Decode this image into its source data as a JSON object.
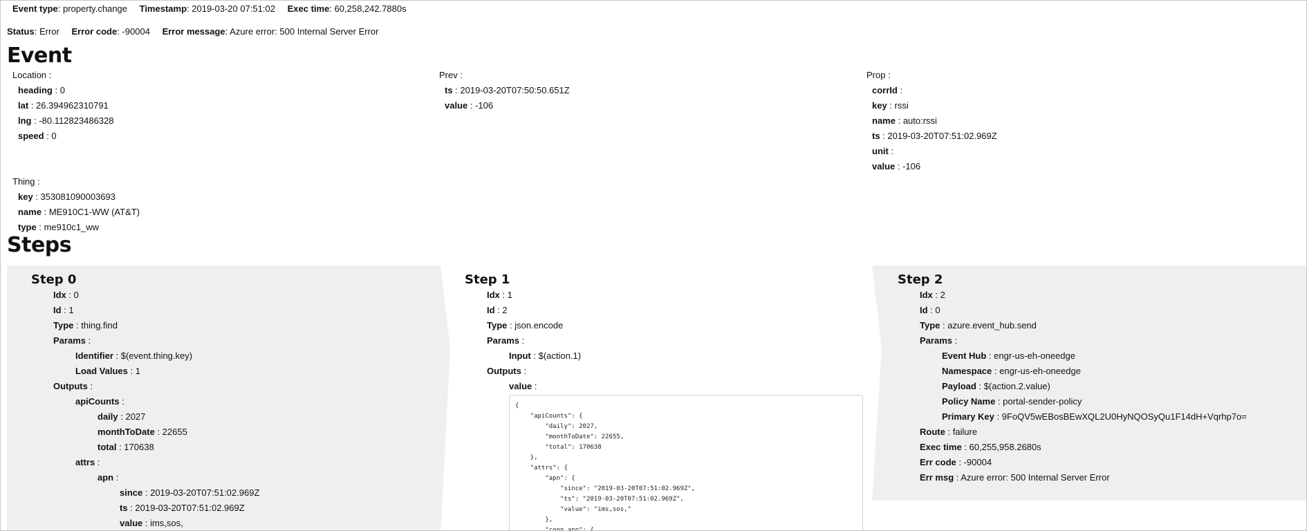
{
  "header": {
    "event_type_label": "Event type",
    "event_type": "property.change",
    "timestamp_label": "Timestamp",
    "timestamp": "2019-03-20 07:51:02",
    "exec_time_label": "Exec time",
    "exec_time": "60,258,242.7880s",
    "status_label": "Status",
    "status": "Error",
    "error_code_label": "Error code",
    "error_code": "-90004",
    "error_message_label": "Error message",
    "error_message": "Azure error: 500 Internal Server Error"
  },
  "event": {
    "title": "Event",
    "location": {
      "label": "Location",
      "fields": [
        {
          "k": "heading",
          "v": "0"
        },
        {
          "k": "lat",
          "v": "26.394962310791"
        },
        {
          "k": "lng",
          "v": "-80.112823486328"
        },
        {
          "k": "speed",
          "v": "0"
        }
      ]
    },
    "thing": {
      "label": "Thing",
      "fields": [
        {
          "k": "key",
          "v": "353081090003693"
        },
        {
          "k": "name",
          "v": "ME910C1-WW (AT&T)"
        },
        {
          "k": "type",
          "v": "me910c1_ww"
        }
      ]
    },
    "prev": {
      "label": "Prev",
      "fields": [
        {
          "k": "ts",
          "v": "2019-03-20T07:50:50.651Z"
        },
        {
          "k": "value",
          "v": "-106"
        }
      ]
    },
    "prop": {
      "label": "Prop",
      "fields": [
        {
          "k": "corrId",
          "v": ""
        },
        {
          "k": "key",
          "v": "rssi"
        },
        {
          "k": "name",
          "v": "auto:rssi"
        },
        {
          "k": "ts",
          "v": "2019-03-20T07:51:02.969Z"
        },
        {
          "k": "unit",
          "v": ""
        },
        {
          "k": "value",
          "v": "-106"
        }
      ]
    }
  },
  "steps": {
    "title": "Steps",
    "items": [
      {
        "title": "Step 0",
        "lines": [
          {
            "k": "Idx",
            "v": "0",
            "indent": 0
          },
          {
            "k": "Id",
            "v": "1",
            "indent": 0
          },
          {
            "k": "Type",
            "v": "thing.find",
            "indent": 0
          },
          {
            "k": "Params",
            "v": "",
            "indent": 0
          },
          {
            "k": "Identifier",
            "v": "$(event.thing.key)",
            "indent": 1
          },
          {
            "k": "Load Values",
            "v": "1",
            "indent": 1
          },
          {
            "k": "Outputs",
            "v": "",
            "indent": 0
          },
          {
            "k": "apiCounts",
            "v": "",
            "indent": 1
          },
          {
            "k": "daily",
            "v": "2027",
            "indent": 2
          },
          {
            "k": "monthToDate",
            "v": "22655",
            "indent": 2
          },
          {
            "k": "total",
            "v": "170638",
            "indent": 2
          },
          {
            "k": "attrs",
            "v": "",
            "indent": 1
          },
          {
            "k": "apn",
            "v": "",
            "indent": 2
          },
          {
            "k": "since",
            "v": "2019-03-20T07:51:02.969Z",
            "indent": 3
          },
          {
            "k": "ts",
            "v": "2019-03-20T07:51:02.969Z",
            "indent": 3
          },
          {
            "k": "value",
            "v": "ims,sos,",
            "indent": 3
          }
        ]
      },
      {
        "title": "Step 1",
        "lines": [
          {
            "k": "Idx",
            "v": "1",
            "indent": 0
          },
          {
            "k": "Id",
            "v": "2",
            "indent": 0
          },
          {
            "k": "Type",
            "v": "json.encode",
            "indent": 0
          },
          {
            "k": "Params",
            "v": "",
            "indent": 0
          },
          {
            "k": "Input",
            "v": "$(action.1)",
            "indent": 1
          },
          {
            "k": "Outputs",
            "v": "",
            "indent": 0
          },
          {
            "k": "value",
            "v": "",
            "indent": 1
          }
        ],
        "code": "{\n    \"apiCounts\": {\n        \"daily\": 2027,\n        \"monthToDate\": 22655,\n        \"total\": 170638\n    },\n    \"attrs\": {\n        \"apn\": {\n            \"since\": \"2019-03-20T07:51:02.969Z\",\n            \"ts\": \"2019-03-20T07:51:02.969Z\",\n            \"value\": \"ims,sos,\"\n        },\n        \"conn_apn\": {"
      },
      {
        "title": "Step 2",
        "lines": [
          {
            "k": "Idx",
            "v": "2",
            "indent": 0
          },
          {
            "k": "Id",
            "v": "0",
            "indent": 0
          },
          {
            "k": "Type",
            "v": "azure.event_hub.send",
            "indent": 0
          },
          {
            "k": "Params",
            "v": "",
            "indent": 0
          },
          {
            "k": "Event Hub",
            "v": "engr-us-eh-oneedge",
            "indent": 1
          },
          {
            "k": "Namespace",
            "v": "engr-us-eh-oneedge",
            "indent": 1
          },
          {
            "k": "Payload",
            "v": "$(action.2.value)",
            "indent": 1
          },
          {
            "k": "Policy Name",
            "v": "portal-sender-policy",
            "indent": 1
          },
          {
            "k": "Primary Key",
            "v": "9FoQV5wEBosBEwXQL2U0HyNQOSyQu1F14dH+Vqrhp7o=",
            "indent": 1
          },
          {
            "k": "Route",
            "v": "failure",
            "indent": 0
          },
          {
            "k": "Exec time",
            "v": "60,255,958.2680s",
            "indent": 0
          },
          {
            "k": "Err code",
            "v": "-90004",
            "indent": 0
          },
          {
            "k": "Err msg",
            "v": "Azure error: 500 Internal Server Error",
            "indent": 0
          }
        ]
      }
    ]
  }
}
